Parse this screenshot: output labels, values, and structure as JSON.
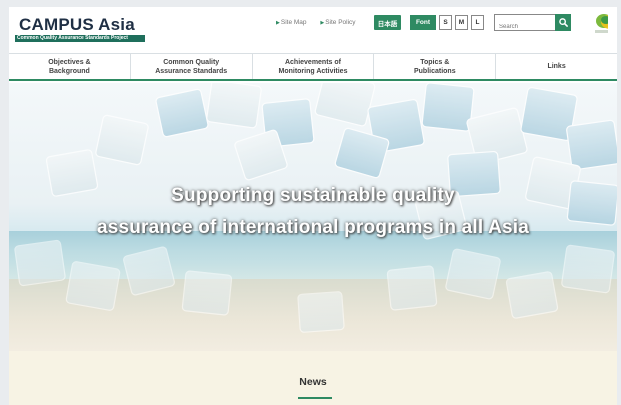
{
  "site": {
    "logo_title": "CAMPUS Asia",
    "logo_subtitle": "Common Quality Assurance Standards Project"
  },
  "utility": {
    "sitemap_label": "Site Map",
    "policy_label": "Site Policy",
    "language_label": "日本語",
    "font_label": "Font",
    "font_sizes": [
      "S",
      "M",
      "L"
    ],
    "search_placeholder": "Search"
  },
  "nav": {
    "items": [
      {
        "line1": "Objectives &",
        "line2": "Background"
      },
      {
        "line1": "Common Quality",
        "line2": "Assurance Standards"
      },
      {
        "line1": "Achievements of",
        "line2": "Monitoring Activities"
      },
      {
        "line1": "Topics &",
        "line2": "Publications"
      },
      {
        "line1": "Links",
        "line2": ""
      }
    ]
  },
  "hero": {
    "line1": "Supporting sustainable quality",
    "line2": "assurance of international programs in all Asia"
  },
  "news": {
    "title": "News"
  },
  "colors": {
    "accent_green": "#2e8a62",
    "logo_navy": "#1f2f44",
    "news_bg": "#f7f3e4"
  },
  "icons": {
    "search": "search-icon",
    "brand": "brand-mark-icon",
    "bullet": "triangle-bullet-icon"
  }
}
